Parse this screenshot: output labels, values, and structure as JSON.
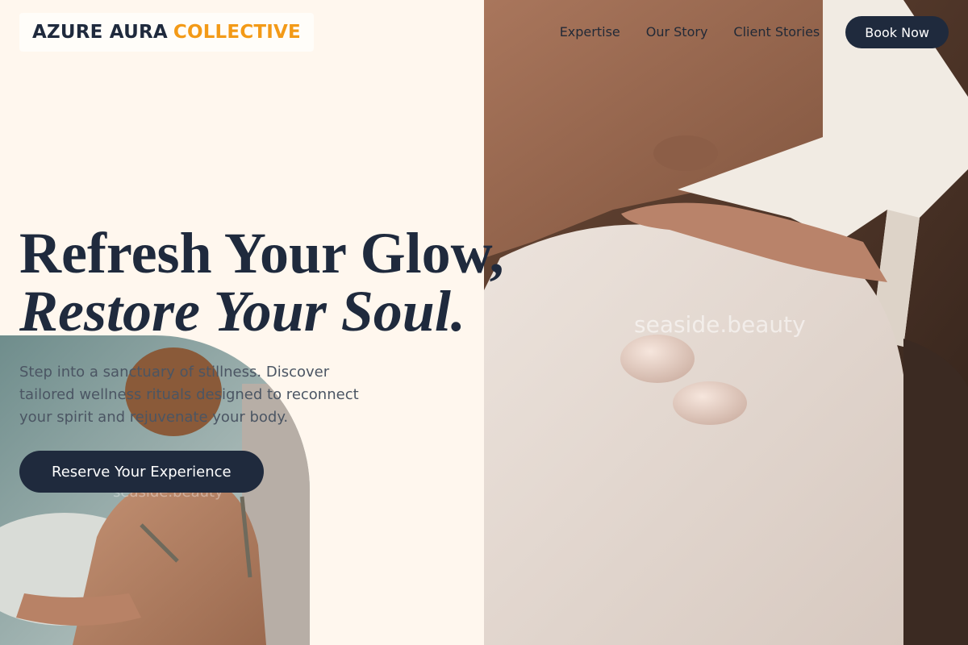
{
  "brand": {
    "name_part1": "AZURE AURA",
    "name_part2": "COLLECTIVE"
  },
  "nav": {
    "links": [
      "Expertise",
      "Our Story",
      "Client Stories"
    ],
    "book_label": "Book Now"
  },
  "hero": {
    "headline_line1": "Refresh Your Glow,",
    "headline_line2": "Restore Your Soul.",
    "body": "Step into a sanctuary of stillness. Discover tailored wellness rituals designed to reconnect your spirit and rejuvenate your body.",
    "cta_label": "Reserve Your Experience"
  },
  "images": {
    "hero_watermark": "seaside.beauty",
    "side_watermark": "seaside.beauty"
  },
  "colors": {
    "background": "#fff7ee",
    "navy": "#1f2a3d",
    "accent_orange": "#f39a17"
  }
}
